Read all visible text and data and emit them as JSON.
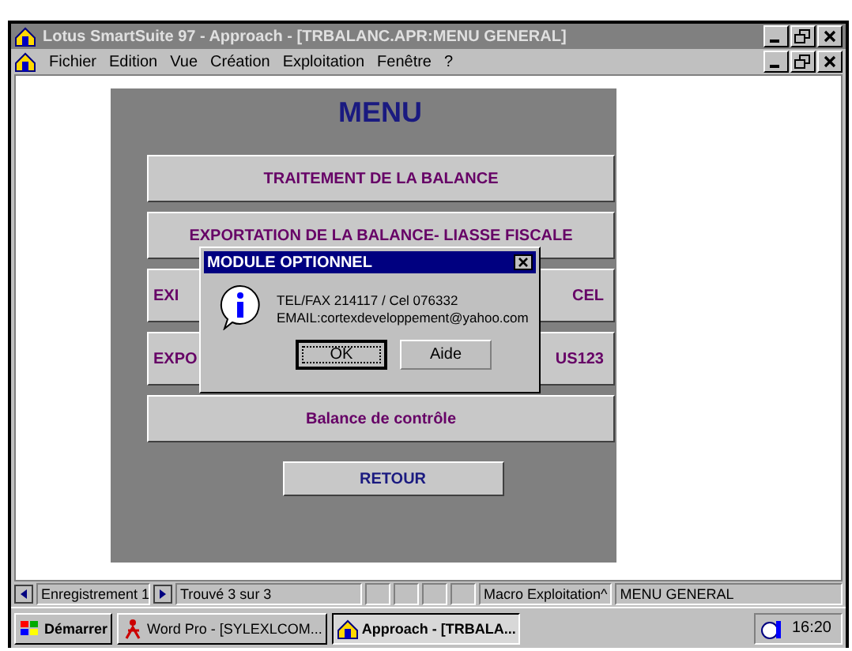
{
  "window": {
    "title": "Lotus SmartSuite 97   -  Approach - [TRBALANC.APR:MENU GENERAL]"
  },
  "menu_bar": {
    "items": [
      "Fichier",
      "Edition",
      "Vue",
      "Création",
      "Exploitation",
      "Fenêtre",
      "?"
    ]
  },
  "form": {
    "title": "MENU",
    "buttons": [
      {
        "kind": "full",
        "label": "TRAITEMENT DE LA BALANCE"
      },
      {
        "kind": "full",
        "label": "EXPORTATION DE LA BALANCE- LIASSE FISCALE"
      },
      {
        "kind": "split",
        "left": "EXI",
        "right": "CEL"
      },
      {
        "kind": "split",
        "left": "EXPO",
        "right": "US123"
      },
      {
        "kind": "full",
        "label": "Balance de contrôle"
      }
    ],
    "back_button": "RETOUR"
  },
  "dialog": {
    "title": "MODULE OPTIONNEL",
    "lines": [
      "TEL/FAX 214117 / Cel 076332",
      "EMAIL:cortexdeveloppement@yahoo.com"
    ],
    "buttons": [
      {
        "label": "OK",
        "selected": true
      },
      {
        "label": "Aide",
        "selected": false
      }
    ]
  },
  "status_bar": {
    "record": "Enregistrement 1",
    "found": "Trouvé 3 sur 3",
    "macro": "Macro Exploitation^",
    "view": "MENU GENERAL"
  },
  "taskbar": {
    "start": "Démarrer",
    "tasks": [
      {
        "label": "Word Pro - [SYLEXLCOM...",
        "selected": false
      },
      {
        "label": "Approach - [TRBALA...",
        "selected": true
      }
    ],
    "clock": "16:20"
  }
}
